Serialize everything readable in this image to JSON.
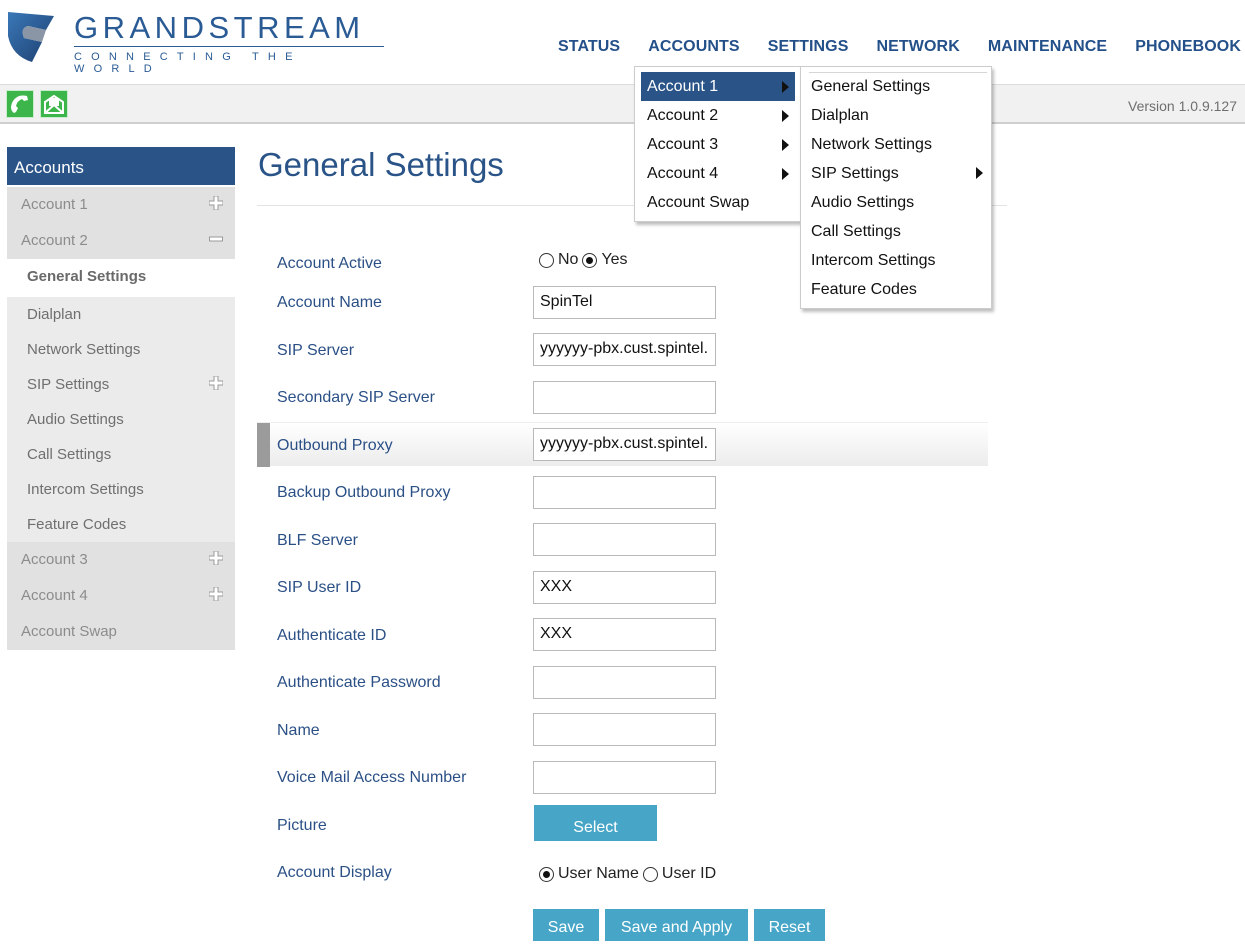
{
  "brand": {
    "name": "GRANDSTREAM",
    "tagline": "CONNECTING THE WORLD",
    "colors": {
      "primary": "#2a5488",
      "nav": "#24508a",
      "button": "#47a6c8",
      "icon_green": "#3cb54a"
    }
  },
  "topnav": {
    "items": [
      {
        "label": "STATUS"
      },
      {
        "label": "ACCOUNTS"
      },
      {
        "label": "SETTINGS"
      },
      {
        "label": "NETWORK"
      },
      {
        "label": "MAINTENANCE"
      },
      {
        "label": "PHONEBOOK"
      }
    ]
  },
  "toolbar": {
    "icons": [
      "phone-icon",
      "message-icon"
    ],
    "version": "Version 1.0.9.127"
  },
  "accounts_menu": {
    "items": [
      {
        "label": "Account 1",
        "submenu": true,
        "selected": true
      },
      {
        "label": "Account 2",
        "submenu": true
      },
      {
        "label": "Account 3",
        "submenu": true
      },
      {
        "label": "Account 4",
        "submenu": true
      },
      {
        "label": "Account Swap",
        "submenu": false
      }
    ]
  },
  "account_submenu": {
    "items": [
      {
        "label": "General Settings"
      },
      {
        "label": "Dialplan"
      },
      {
        "label": "Network Settings"
      },
      {
        "label": "SIP Settings",
        "submenu": true
      },
      {
        "label": "Audio Settings"
      },
      {
        "label": "Call Settings"
      },
      {
        "label": "Intercom Settings"
      },
      {
        "label": "Feature Codes"
      }
    ]
  },
  "sidebar": {
    "title": "Accounts",
    "account1": {
      "label": "Account 1",
      "state": "collapsed"
    },
    "account2": {
      "label": "Account 2",
      "state": "expanded"
    },
    "sub_items": [
      {
        "label": "General Settings",
        "active": true
      },
      {
        "label": "Dialplan"
      },
      {
        "label": "Network Settings"
      },
      {
        "label": "SIP Settings",
        "expandable": true
      },
      {
        "label": "Audio Settings"
      },
      {
        "label": "Call Settings"
      },
      {
        "label": "Intercom Settings"
      },
      {
        "label": "Feature Codes"
      }
    ],
    "account3": {
      "label": "Account 3",
      "state": "collapsed"
    },
    "account4": {
      "label": "Account 4",
      "state": "collapsed"
    },
    "swap": {
      "label": "Account Swap"
    }
  },
  "main": {
    "title": "General Settings",
    "account_active": {
      "label": "Account Active",
      "options": [
        "No",
        "Yes"
      ],
      "selected": "Yes"
    },
    "fields": [
      {
        "label": "Account Name",
        "value": "SpinTel"
      },
      {
        "label": "SIP Server",
        "value": "yyyyyy-pbx.cust.spintel."
      },
      {
        "label": "Secondary SIP Server",
        "value": ""
      },
      {
        "label": "Outbound Proxy",
        "value": "yyyyyy-pbx.cust.spintel.",
        "highlighted": true
      },
      {
        "label": "Backup Outbound Proxy",
        "value": ""
      },
      {
        "label": "BLF Server",
        "value": ""
      },
      {
        "label": "SIP User ID",
        "value": "XXX"
      },
      {
        "label": "Authenticate ID",
        "value": "XXX"
      },
      {
        "label": "Authenticate Password",
        "value": ""
      },
      {
        "label": "Name",
        "value": ""
      },
      {
        "label": "Voice Mail Access Number",
        "value": ""
      }
    ],
    "picture": {
      "label": "Picture",
      "button": "Select"
    },
    "account_display": {
      "label": "Account Display",
      "options": [
        "User Name",
        "User ID"
      ],
      "selected": "User Name"
    },
    "actions": {
      "save": "Save",
      "save_apply": "Save and Apply",
      "reset": "Reset"
    }
  }
}
